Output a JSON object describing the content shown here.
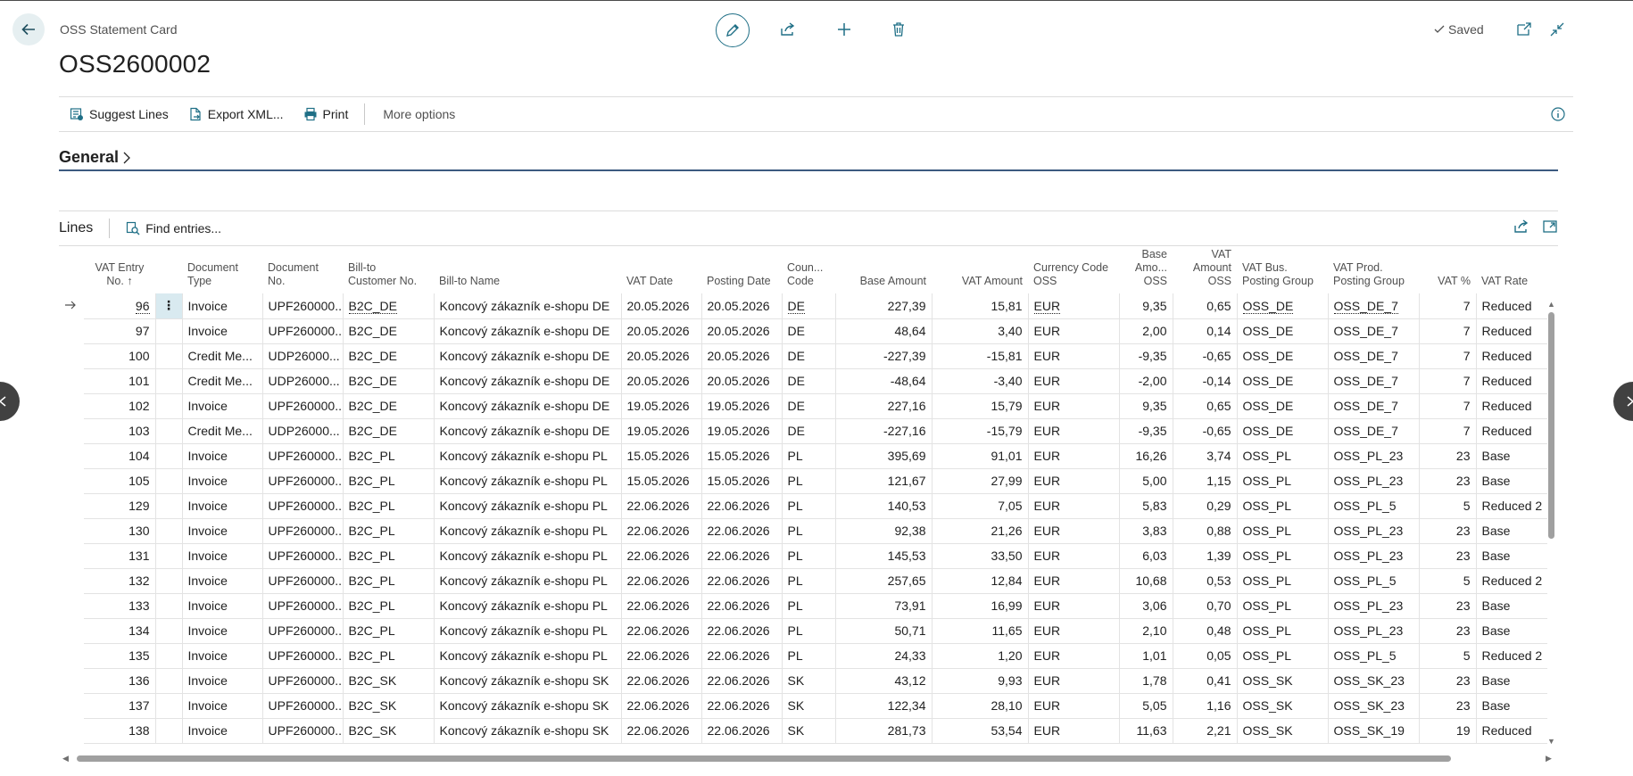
{
  "header": {
    "caption": "OSS Statement Card",
    "title": "OSS2600002",
    "saved_label": "Saved"
  },
  "actions": {
    "suggest_lines": "Suggest Lines",
    "export_xml": "Export XML...",
    "print": "Print",
    "more_options": "More options"
  },
  "general": {
    "title": "General"
  },
  "lines": {
    "title": "Lines",
    "find_entries": "Find entries...",
    "columns": {
      "vat_entry_no_1": "VAT Entry",
      "vat_entry_no_2": "No.",
      "document_type_1": "Document",
      "document_type_2": "Type",
      "document_no_1": "Document",
      "document_no_2": "No.",
      "bill_to_customer_1": "Bill-to",
      "bill_to_customer_2": "Customer No.",
      "bill_to_name": "Bill-to Name",
      "vat_date": "VAT Date",
      "posting_date": "Posting Date",
      "country_code_1": "Coun...",
      "country_code_2": "Code",
      "base_amount": "Base Amount",
      "vat_amount": "VAT Amount",
      "currency_code_1": "Currency Code",
      "currency_code_2": "OSS",
      "base_amount_oss_1": "Base",
      "base_amount_oss_2": "Amo...",
      "base_amount_oss_3": "OSS",
      "vat_amount_oss_1": "VAT",
      "vat_amount_oss_2": "Amount",
      "vat_amount_oss_3": "OSS",
      "vat_bus_group_1": "VAT Bus.",
      "vat_bus_group_2": "Posting Group",
      "vat_prod_group_1": "VAT Prod.",
      "vat_prod_group_2": "Posting Group",
      "vat_pct": "VAT %",
      "vat_rate": "VAT Rate"
    },
    "rows": [
      [
        "96",
        "Invoice",
        "UPF260000...",
        "B2C_DE",
        "Koncový zákazník e-shopu DE",
        "20.05.2026",
        "20.05.2026",
        "DE",
        "227,39",
        "15,81",
        "EUR",
        "9,35",
        "0,65",
        "OSS_DE",
        "OSS_DE_7",
        "7",
        "Reduced"
      ],
      [
        "97",
        "Invoice",
        "UPF260000...",
        "B2C_DE",
        "Koncový zákazník e-shopu DE",
        "20.05.2026",
        "20.05.2026",
        "DE",
        "48,64",
        "3,40",
        "EUR",
        "2,00",
        "0,14",
        "OSS_DE",
        "OSS_DE_7",
        "7",
        "Reduced"
      ],
      [
        "100",
        "Credit Me...",
        "UDP26000...",
        "B2C_DE",
        "Koncový zákazník e-shopu DE",
        "20.05.2026",
        "20.05.2026",
        "DE",
        "-227,39",
        "-15,81",
        "EUR",
        "-9,35",
        "-0,65",
        "OSS_DE",
        "OSS_DE_7",
        "7",
        "Reduced"
      ],
      [
        "101",
        "Credit Me...",
        "UDP26000...",
        "B2C_DE",
        "Koncový zákazník e-shopu DE",
        "20.05.2026",
        "20.05.2026",
        "DE",
        "-48,64",
        "-3,40",
        "EUR",
        "-2,00",
        "-0,14",
        "OSS_DE",
        "OSS_DE_7",
        "7",
        "Reduced"
      ],
      [
        "102",
        "Invoice",
        "UPF260000...",
        "B2C_DE",
        "Koncový zákazník e-shopu DE",
        "19.05.2026",
        "19.05.2026",
        "DE",
        "227,16",
        "15,79",
        "EUR",
        "9,35",
        "0,65",
        "OSS_DE",
        "OSS_DE_7",
        "7",
        "Reduced"
      ],
      [
        "103",
        "Credit Me...",
        "UDP26000...",
        "B2C_DE",
        "Koncový zákazník e-shopu DE",
        "19.05.2026",
        "19.05.2026",
        "DE",
        "-227,16",
        "-15,79",
        "EUR",
        "-9,35",
        "-0,65",
        "OSS_DE",
        "OSS_DE_7",
        "7",
        "Reduced"
      ],
      [
        "104",
        "Invoice",
        "UPF260000...",
        "B2C_PL",
        "Koncový zákazník e-shopu PL",
        "15.05.2026",
        "15.05.2026",
        "PL",
        "395,69",
        "91,01",
        "EUR",
        "16,26",
        "3,74",
        "OSS_PL",
        "OSS_PL_23",
        "23",
        "Base"
      ],
      [
        "105",
        "Invoice",
        "UPF260000...",
        "B2C_PL",
        "Koncový zákazník e-shopu PL",
        "15.05.2026",
        "15.05.2026",
        "PL",
        "121,67",
        "27,99",
        "EUR",
        "5,00",
        "1,15",
        "OSS_PL",
        "OSS_PL_23",
        "23",
        "Base"
      ],
      [
        "129",
        "Invoice",
        "UPF260000...",
        "B2C_PL",
        "Koncový zákazník e-shopu PL",
        "22.06.2026",
        "22.06.2026",
        "PL",
        "140,53",
        "7,05",
        "EUR",
        "5,83",
        "0,29",
        "OSS_PL",
        "OSS_PL_5",
        "5",
        "Reduced 2"
      ],
      [
        "130",
        "Invoice",
        "UPF260000...",
        "B2C_PL",
        "Koncový zákazník e-shopu PL",
        "22.06.2026",
        "22.06.2026",
        "PL",
        "92,38",
        "21,26",
        "EUR",
        "3,83",
        "0,88",
        "OSS_PL",
        "OSS_PL_23",
        "23",
        "Base"
      ],
      [
        "131",
        "Invoice",
        "UPF260000...",
        "B2C_PL",
        "Koncový zákazník e-shopu PL",
        "22.06.2026",
        "22.06.2026",
        "PL",
        "145,53",
        "33,50",
        "EUR",
        "6,03",
        "1,39",
        "OSS_PL",
        "OSS_PL_23",
        "23",
        "Base"
      ],
      [
        "132",
        "Invoice",
        "UPF260000...",
        "B2C_PL",
        "Koncový zákazník e-shopu PL",
        "22.06.2026",
        "22.06.2026",
        "PL",
        "257,65",
        "12,84",
        "EUR",
        "10,68",
        "0,53",
        "OSS_PL",
        "OSS_PL_5",
        "5",
        "Reduced 2"
      ],
      [
        "133",
        "Invoice",
        "UPF260000...",
        "B2C_PL",
        "Koncový zákazník e-shopu PL",
        "22.06.2026",
        "22.06.2026",
        "PL",
        "73,91",
        "16,99",
        "EUR",
        "3,06",
        "0,70",
        "OSS_PL",
        "OSS_PL_23",
        "23",
        "Base"
      ],
      [
        "134",
        "Invoice",
        "UPF260000...",
        "B2C_PL",
        "Koncový zákazník e-shopu PL",
        "22.06.2026",
        "22.06.2026",
        "PL",
        "50,71",
        "11,65",
        "EUR",
        "2,10",
        "0,48",
        "OSS_PL",
        "OSS_PL_23",
        "23",
        "Base"
      ],
      [
        "135",
        "Invoice",
        "UPF260000...",
        "B2C_PL",
        "Koncový zákazník e-shopu PL",
        "22.06.2026",
        "22.06.2026",
        "PL",
        "24,33",
        "1,20",
        "EUR",
        "1,01",
        "0,05",
        "OSS_PL",
        "OSS_PL_5",
        "5",
        "Reduced 2"
      ],
      [
        "136",
        "Invoice",
        "UPF260000...",
        "B2C_SK",
        "Koncový zákazník e-shopu SK",
        "22.06.2026",
        "22.06.2026",
        "SK",
        "43,12",
        "9,93",
        "EUR",
        "1,78",
        "0,41",
        "OSS_SK",
        "OSS_SK_23",
        "23",
        "Base"
      ],
      [
        "137",
        "Invoice",
        "UPF260000...",
        "B2C_SK",
        "Koncový zákazník e-shopu SK",
        "22.06.2026",
        "22.06.2026",
        "SK",
        "122,34",
        "28,10",
        "EUR",
        "5,05",
        "1,16",
        "OSS_SK",
        "OSS_SK_23",
        "23",
        "Base"
      ],
      [
        "138",
        "Invoice",
        "UPF260000...",
        "B2C_SK",
        "Koncový zákazník e-shopu SK",
        "22.06.2026",
        "22.06.2026",
        "SK",
        "281,73",
        "53,54",
        "EUR",
        "11,63",
        "2,21",
        "OSS_SK",
        "OSS_SK_19",
        "19",
        "Reduced"
      ]
    ]
  },
  "colors": {
    "accent": "#1f6f86",
    "section_underline": "#3c5a80",
    "selected_cell": "#d9eaf0"
  },
  "icons": [
    "back-arrow-icon",
    "edit-icon",
    "share-icon",
    "add-icon",
    "delete-icon",
    "checkmark-icon",
    "open-new-window-icon",
    "collapse-icon",
    "suggest-lines-icon",
    "export-icon",
    "print-icon",
    "info-icon",
    "chevron-right-icon",
    "find-icon",
    "row-arrow-icon",
    "row-menu-icon",
    "chevron-left-icon"
  ]
}
